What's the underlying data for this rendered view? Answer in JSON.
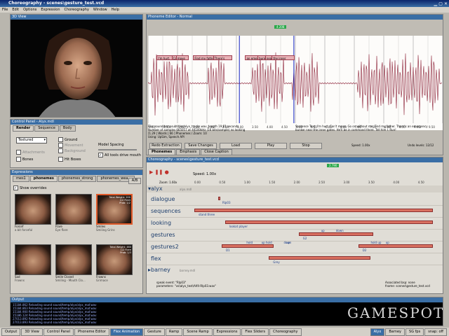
{
  "window": {
    "title": "Choreography - scenes\\gesture_test.vcd"
  },
  "menu": [
    "File",
    "Edit",
    "Options",
    "Expression",
    "Choreography",
    "Window",
    "Help"
  ],
  "view3d": {
    "title": "3D View"
  },
  "control_panel": {
    "title": "Control Panel - Alyx.mdl",
    "tabs": [
      "Render",
      "Sequence",
      "Body"
    ],
    "render_mode": "Textured",
    "checks_left": [
      {
        "label": "Ground",
        "checked": false
      },
      {
        "label": "Movement",
        "checked": false
      },
      {
        "label": "Background",
        "checked": false
      }
    ],
    "attachments": "Attachments",
    "bones": "Bones",
    "hitboxes": "Hit Boxes",
    "model_spacing": "Model Spacing",
    "all_tools": "All tools drive mouth"
  },
  "expressions": {
    "title": "Expressions",
    "tabs": [
      "mes1",
      "phonemes",
      "phonemes_strong",
      "phonemes_wea..."
    ],
    "ab": "A/B",
    "show_overrides": "Show overrides",
    "cards": [
      {
        "name": "Forcef",
        "desc": "a bit forceful",
        "weight": ""
      },
      {
        "name": "Flare",
        "desc": "Eye flare",
        "weight": ""
      },
      {
        "name": "Smiles",
        "desc": "Smiling Grins",
        "weight": "Total Weight: 200\n1/2 Fleet\nProb: 1/2"
      },
      {
        "name": "Sad",
        "desc": "Frowns",
        "weight": ""
      },
      {
        "name": "Smile Closed",
        "desc": "Smiling - Mouth Clo...",
        "weight": ""
      },
      {
        "name": "Frowns",
        "desc": "Grimace",
        "weight": "Total Weight: 460\n1/2 Flare\nProb: 1/3"
      }
    ]
  },
  "phoneme_editor": {
    "title": "Phoneme Editor - Normal",
    "time_marker": "4.208",
    "phonemes": [
      {
        "label": "I'm hurt.",
        "start": 0.7
      },
      {
        "label": "Can't",
        "start": 1.9
      },
      {
        "label": "move",
        "start": 2.25
      },
      {
        "label": "Find my father",
        "start": 3.65
      },
      {
        "label": "There's",
        "start": 5.25
      },
      {
        "label": "an emergency",
        "start": 7.85
      },
      {
        "label": "bunker",
        "start": 8.85
      },
      {
        "label": "near",
        "start": 9.45
      },
      {
        "label": "the inner",
        "start": 10.0
      }
    ],
    "time_ticks": [
      "0.00",
      "0.50",
      "1.00",
      "1.50",
      "2.00",
      "2.50",
      "3.00",
      "3.50",
      "4.00",
      "4.50",
      "5.00",
      "5.50",
      "6.00",
      "6.50",
      "7.00",
      "7.50",
      "8.00",
      "8.50",
      "9.00",
      "9.50"
    ],
    "info_left": "File: sound/tempsubtitles/alyx_tracks.wav, length 19.81 seconds\nNumber of samples 665057 at 44100kHz (16 bits/sample) no looking\n[1.29 | Words | 66 ] Phonemes / Zoom: 10\nUsing: UpSim, Speech API",
    "info_right": "Sentence Text: I'm hurt. Can't move. Go on without me. Find my father. There's an emergency\nbunker near the inner gates. He'll be in command there. Tell him I. Run!",
    "buttons": [
      "Redo Extraction",
      "Save Changes",
      "Load",
      "Play",
      "Stop"
    ],
    "speed": "Speed: 1.00x",
    "undo": "Undo levels: 12/12",
    "mode_tabs": [
      "Phonemes",
      "Emphasis",
      "Close Caption"
    ]
  },
  "choreo": {
    "title": "Choreography - scenes\\gesture_test.vcd",
    "marker": "2.790",
    "zoom": "Zoom: 1.60x",
    "speed": "Speed: 1.00x",
    "ticks": [
      "0.00",
      "0.50",
      "1.00",
      "1.50",
      "2.00",
      "2.50",
      "3.00",
      "3.50",
      "4.00",
      "4.50"
    ],
    "actor": "alyx",
    "actor_model": "alyx.mdl",
    "tracks": [
      {
        "name": "dialogue",
        "events": [
          {
            "label": "Rlp03",
            "start": 0.48,
            "end": 0.52
          }
        ]
      },
      {
        "name": "sequences",
        "events": [
          {
            "label": "stand three",
            "start": 0.0,
            "end": 4.8
          }
        ]
      },
      {
        "name": "looking",
        "events": [
          {
            "label": "lookat player",
            "start": 0.62,
            "end": 4.8
          }
        ]
      },
      {
        "name": "gestures",
        "events": [
          {
            "label": "G2",
            "start": 2.1,
            "end": 3.6
          }
        ]
      },
      {
        "name": "gestures2",
        "events": [
          {
            "label": "D1",
            "start": 0.55,
            "end": 1.6
          },
          {
            "label": "D2",
            "start": 3.3,
            "end": 4.8
          }
        ]
      },
      {
        "name": "flex",
        "events": [
          {
            "label": "Grey",
            "start": 1.5,
            "end": 3.55
          }
        ]
      }
    ],
    "event_labels": [
      {
        "text": "hold",
        "t": 1.05,
        "row": 4
      },
      {
        "text": "up hold",
        "t": 1.35,
        "row": 4
      },
      {
        "text": "up",
        "t": 1.85,
        "row": 4
      },
      {
        "text": "hold up",
        "t": 3.55,
        "row": 4
      },
      {
        "text": "up",
        "t": 3.85,
        "row": 4
      },
      {
        "text": "up",
        "t": 2.55,
        "row": 3
      },
      {
        "text": "down",
        "t": 2.85,
        "row": 3
      },
      {
        "text": "down",
        "t": 1.8,
        "row": 4
      }
    ],
    "actor2": "barney",
    "actor2_model": "barney.mdl",
    "speak_info": "speak event: \"Rlp03\"\nparameters: \"vo\\alyx_test\\Alf4-Rlp03.wav\"",
    "assoc": "Associated bsp: none\nfname: scenes\\gesture_test.vcd"
  },
  "output": {
    "title": "Output",
    "lines": [
      "15184.862  Reloading sound sound/temp/alyx/alyx_maf.wav",
      "15184.863  Reloading sound sound/temp/alyx/alyx_maf.wav",
      "15184.900  Reloading sound sound/temp/alyx/alyx_maf.wav",
      "15186.124  Reloading sound sound/temp/alyx/alyx_maf.wav",
      "27013.892  Reloading sound sound/temp/alyx/alyx_maf.wav",
      "27013.893  Reloading sound sound/temp/alyx/alyx_maf.wav"
    ],
    "watermark": "GAMESPOT"
  },
  "taskbar": {
    "tabs": [
      "Output",
      "3D View",
      "Control Panel",
      "Phoneme Editor",
      "Flex Animation",
      "Gesture",
      "Ramp",
      "Scene Ramp",
      "Expressions",
      "Flex Sliders",
      "Choreography"
    ],
    "active": "Flex Animation",
    "right": [
      "Alyx",
      "Barney",
      "SG fps",
      "snap: off"
    ]
  }
}
